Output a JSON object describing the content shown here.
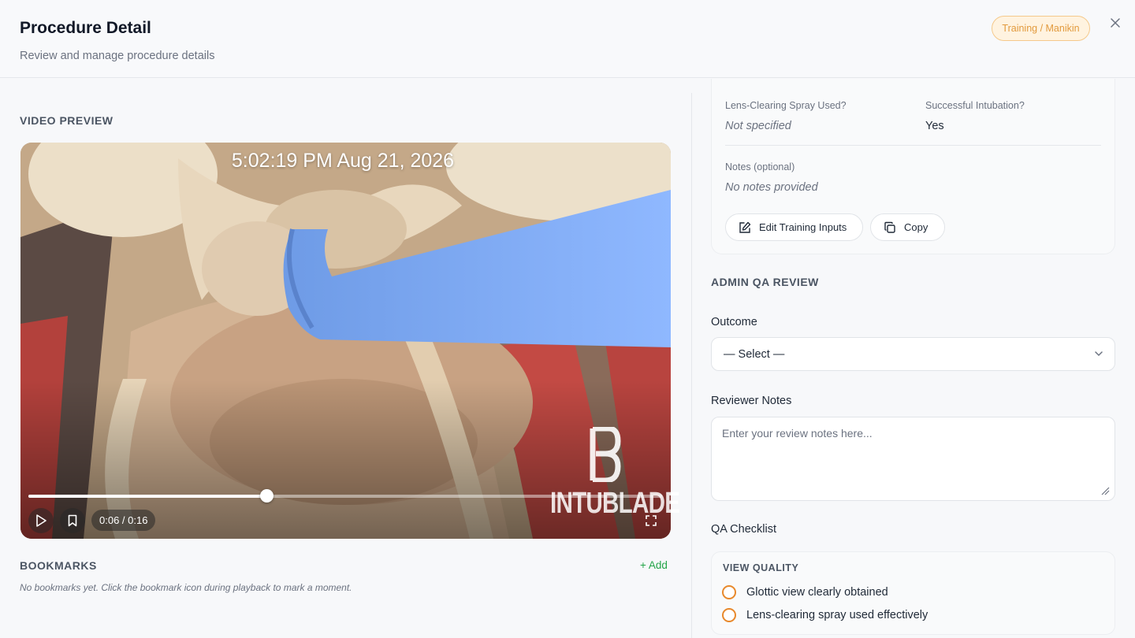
{
  "header": {
    "title": "Procedure Detail",
    "subtitle": "Review and manage procedure details",
    "badge": "Training / Manikin",
    "close_icon": "close-icon"
  },
  "video": {
    "section_label": "VIDEO PREVIEW",
    "timestamp": "5:02:19 PM Aug 21, 2026",
    "watermark": "INTUBLADE",
    "current_time": "0:06",
    "duration": "0:16",
    "time_display": "0:06 / 0:16",
    "progress": 0.375
  },
  "bookmarks": {
    "section_label": "BOOKMARKS",
    "add_label": "+ Add",
    "empty_text": "No bookmarks yet. Click the bookmark icon during playback to mark a moment."
  },
  "training_inputs": {
    "lens_spray": {
      "label": "Lens-Clearing Spray Used?",
      "value": "Not specified"
    },
    "intubation": {
      "label": "Successful Intubation?",
      "value": "Yes"
    },
    "notes": {
      "label": "Notes (optional)",
      "value": "No notes provided"
    },
    "edit_button": "Edit Training Inputs",
    "copy_button": "Copy"
  },
  "admin_qa": {
    "section_label": "ADMIN QA REVIEW",
    "outcome_label": "Outcome",
    "outcome_value": "— Select —",
    "reviewer_notes_label": "Reviewer Notes",
    "reviewer_notes_placeholder": "Enter your review notes here...",
    "checklist_label": "QA Checklist",
    "checklist": {
      "heading": "VIEW QUALITY",
      "items": [
        {
          "label": "Glottic view clearly obtained",
          "checked": false
        },
        {
          "label": "Lens-clearing spray used effectively",
          "checked": false
        }
      ]
    }
  },
  "colors": {
    "accent_green": "#22a447",
    "badge_orange": "#e29a3d",
    "checkbox_orange": "#e8892c"
  }
}
